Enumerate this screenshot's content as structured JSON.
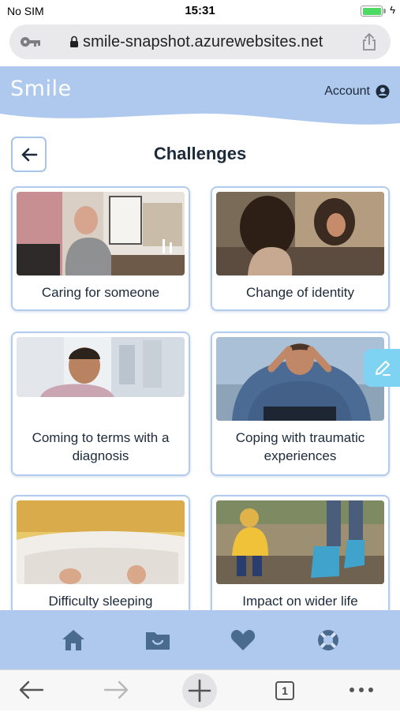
{
  "status_bar": {
    "carrier": "No SIM",
    "time": "15:31",
    "battery_percent": 100
  },
  "browser": {
    "url": "smile-snapshot.azurewebsites.net",
    "tab_count": "1"
  },
  "header": {
    "logo": "Smile",
    "account_label": "Account",
    "background_color": "#afc9ee"
  },
  "page": {
    "title": "Challenges"
  },
  "cards": [
    {
      "label": "Caring for someone",
      "image": "caregiver-photo"
    },
    {
      "label": "Change of identity",
      "image": "mirror-reflection-photo"
    },
    {
      "label": "Coming to terms with a diagnosis",
      "image": "patient-photo"
    },
    {
      "label": "Coping with traumatic experiences",
      "image": "distressed-man-photo"
    },
    {
      "label": "Difficulty sleeping",
      "image": "bed-feet-photo"
    },
    {
      "label": "Impact on wider life",
      "image": "child-wellies-photo"
    }
  ],
  "bottom_nav": [
    {
      "name": "home-icon"
    },
    {
      "name": "folder-smile-icon"
    },
    {
      "name": "heart-icon"
    },
    {
      "name": "lifebuoy-icon"
    }
  ],
  "colors": {
    "accent": "#afc9ee",
    "card_border": "#b3ccee",
    "edit_tab": "#7fd3f2",
    "text": "#1c2a3a"
  }
}
